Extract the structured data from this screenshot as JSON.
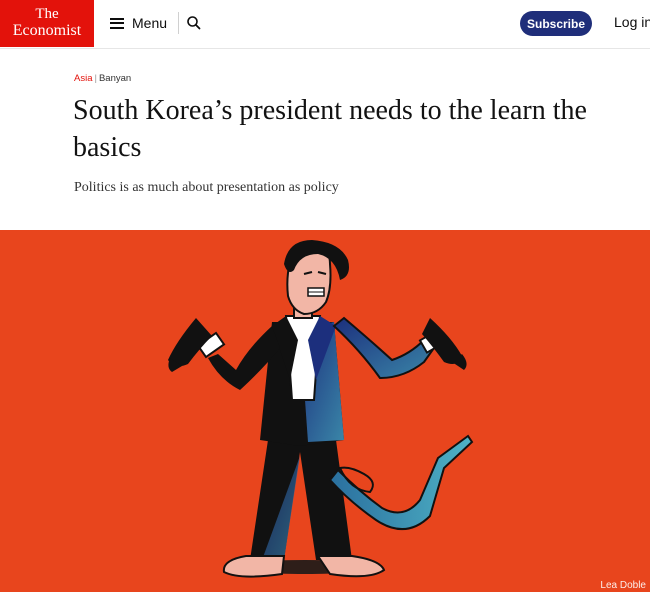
{
  "header": {
    "logo_line1": "The",
    "logo_line2": "Economist",
    "menu_label": "Menu",
    "search_icon": "search-icon",
    "subscribe_label": "Subscribe",
    "login_label": "Log in"
  },
  "article": {
    "section": "Asia",
    "column": "Banyan",
    "headline": "South Korea’s president needs to the learn the basics",
    "standfirst": "Politics is as much about presentation as policy"
  },
  "image": {
    "credit": "Lea Doble"
  },
  "colors": {
    "brand_red": "#e3120b",
    "subscribe_blue": "#1f2e7a",
    "illustration_bg": "#e8451d"
  }
}
